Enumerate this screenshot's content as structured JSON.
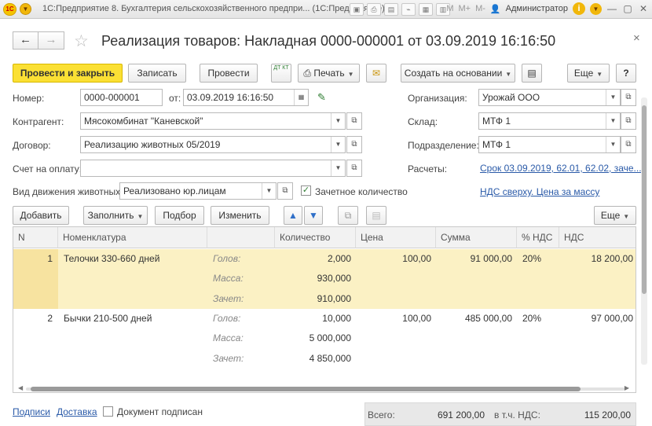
{
  "titlebar": {
    "logo": "1С",
    "title": "1С:Предприятие 8. Бухгалтерия сельскохозяйственного предпри...  (1С:Предприятие)",
    "user": "Администратор",
    "m_labels": [
      "M",
      "M+",
      "M-"
    ]
  },
  "header": {
    "doc_title": "Реализация товаров: Накладная 0000-000001 от 03.09.2019 16:16:50"
  },
  "toolbar": {
    "post_close": "Провести и закрыть",
    "save": "Записать",
    "post": "Провести",
    "dt_kt": "ДТ КТ",
    "print": "Печать",
    "create_based": "Создать на основании",
    "more": "Еще",
    "help": "?"
  },
  "form": {
    "number_label": "Номер:",
    "number_value": "0000-000001",
    "date_label": "от:",
    "date_value": "03.09.2019 16:16:50",
    "counterparty_label": "Контрагент:",
    "counterparty_value": "Мясокомбинат \"Каневской\"",
    "contract_label": "Договор:",
    "contract_value": "Реализацию животных 05/2019",
    "invoice_label": "Счет на оплату:",
    "invoice_value": "",
    "movement_label": "Вид движения животных:",
    "movement_value": "Реализовано юр.лицам",
    "credit_qty_label": "Зачетное количество",
    "org_label": "Организация:",
    "org_value": "Урожай ООО",
    "warehouse_label": "Склад:",
    "warehouse_value": "МТФ 1",
    "division_label": "Подразделение:",
    "division_value": "МТФ 1",
    "settlements_label": "Расчеты:",
    "settlements_link": "Срок 03.09.2019, 62.01, 62.02, заче...",
    "vat_link": "НДС сверху. Цена за массу"
  },
  "table_toolbar": {
    "add": "Добавить",
    "fill": "Заполнить",
    "pick": "Подбор",
    "change": "Изменить",
    "more": "Еще"
  },
  "table": {
    "headers": [
      "N",
      "Номенклатура",
      "",
      "Количество",
      "Цена",
      "Сумма",
      "% НДС",
      "НДС"
    ],
    "rows": [
      {
        "n": "1",
        "name": "Телочки 330-660 дней",
        "sub": [
          {
            "label": "Голов:",
            "qty": "2,000"
          },
          {
            "label": "Масса:",
            "qty": "930,000"
          },
          {
            "label": "Зачет:",
            "qty": "910,000"
          }
        ],
        "price": "100,00",
        "sum": "91 000,00",
        "vat_rate": "20%",
        "vat": "18 200,00"
      },
      {
        "n": "2",
        "name": "Бычки 210-500 дней",
        "sub": [
          {
            "label": "Голов:",
            "qty": "10,000"
          },
          {
            "label": "Масса:",
            "qty": "5 000,000"
          },
          {
            "label": "Зачет:",
            "qty": "4 850,000"
          }
        ],
        "price": "100,00",
        "sum": "485 000,00",
        "vat_rate": "20%",
        "vat": "97 000,00"
      }
    ]
  },
  "footer": {
    "signatures_link": "Подписи",
    "delivery_link": "Доставка",
    "signed_label": "Документ подписан",
    "total_label": "Всего:",
    "total_value": "691 200,00",
    "vat_label": "в т.ч. НДС:",
    "vat_value": "115 200,00"
  },
  "colors": {
    "primary_button": "#fbe034",
    "selected_row": "#fbf1c4",
    "link": "#2a5aa8"
  }
}
